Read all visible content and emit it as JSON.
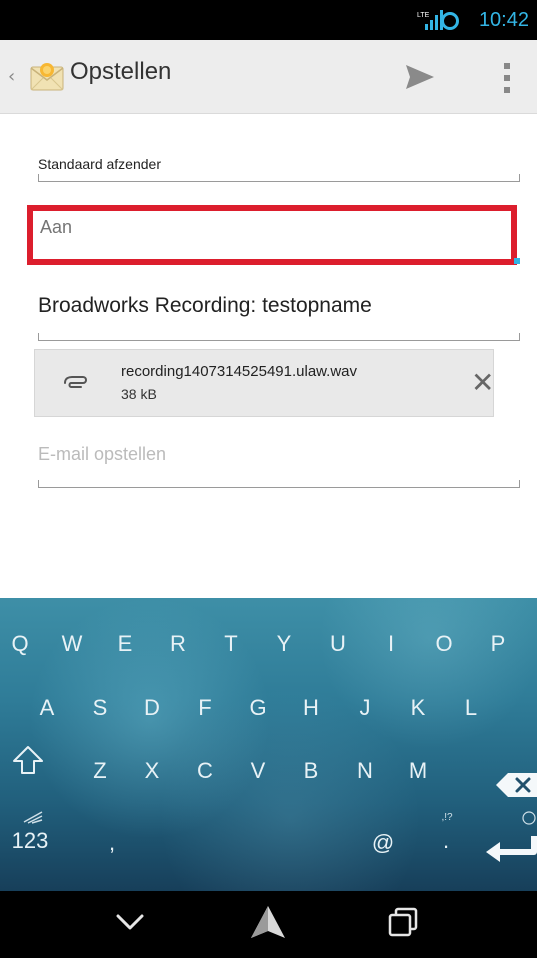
{
  "status_bar": {
    "network": "LTE",
    "time": "10:42"
  },
  "action_bar": {
    "title": "Opstellen",
    "send_icon": "send-icon",
    "overflow_icon": "overflow-menu-icon"
  },
  "compose": {
    "sender_label": "Standaard afzender",
    "to_placeholder": "Aan",
    "subject": "Broadworks Recording: testopname",
    "attachment": {
      "name": "recording1407314525491.ulaw.wav",
      "size": "38 kB"
    },
    "body_placeholder": "E-mail opstellen"
  },
  "keyboard": {
    "row1": [
      "Q",
      "W",
      "E",
      "R",
      "T",
      "Y",
      "U",
      "I",
      "O",
      "P"
    ],
    "row2": [
      "A",
      "S",
      "D",
      "F",
      "G",
      "H",
      "J",
      "K",
      "L"
    ],
    "row3": [
      "Z",
      "X",
      "C",
      "V",
      "B",
      "N",
      "M"
    ],
    "bottom": {
      "symbols": "123",
      "comma": ",",
      "at": "@",
      "period": ".",
      "period_hint": ",!?"
    }
  },
  "colors": {
    "accent": "#33b5e5",
    "highlight": "#dc1e2d"
  }
}
